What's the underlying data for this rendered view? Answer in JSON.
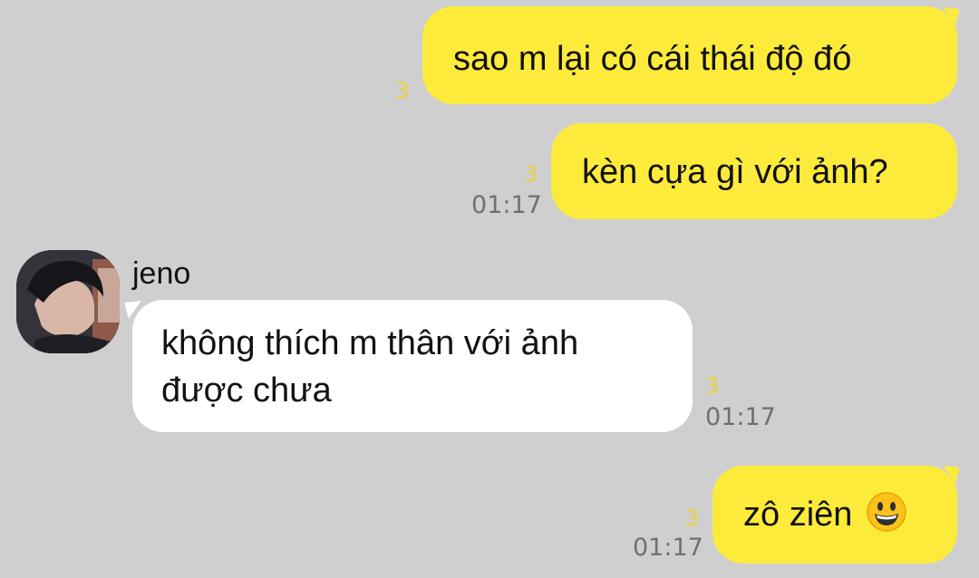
{
  "messages": [
    {
      "direction": "outgoing",
      "text": "sao m lại có cái thái độ đó",
      "unread": "3",
      "time": ""
    },
    {
      "direction": "outgoing",
      "text": "kèn cựa gì với ảnh?",
      "unread": "3",
      "time": "01:17"
    },
    {
      "direction": "incoming",
      "sender": "jeno",
      "line1": "không thích m thân với ảnh",
      "line2": "được chưa",
      "unread": "3",
      "time": "01:17"
    },
    {
      "direction": "outgoing",
      "text": "zô ziên",
      "emoji": "grinning-face-emoji",
      "unread": "3",
      "time": "01:17"
    }
  ],
  "colors": {
    "background": "#cfcfcf",
    "outgoing_bubble": "#fdeb3b",
    "incoming_bubble": "#ffffff",
    "unread_count": "#e8d23a",
    "timestamp": "#707070"
  }
}
